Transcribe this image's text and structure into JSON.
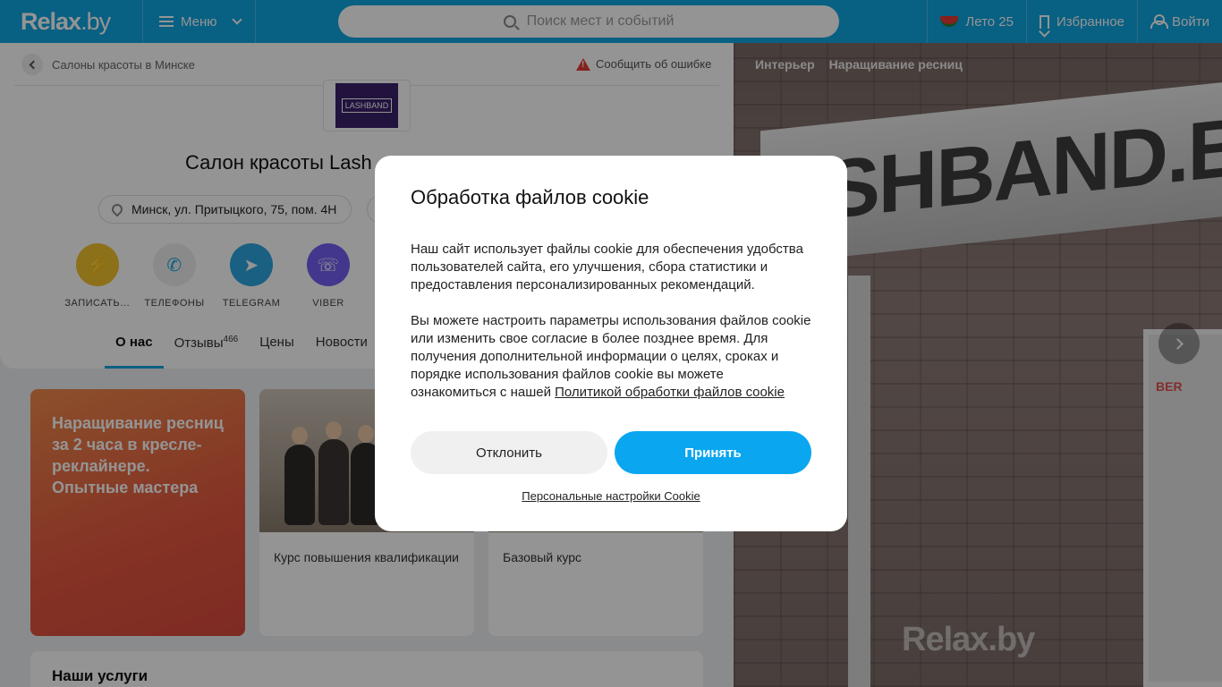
{
  "header": {
    "logo": "Relax",
    "logo_suffix": ".by",
    "menu_label": "Меню",
    "search_placeholder": "Поиск мест и событий",
    "summer_label": "Лето 25",
    "favorites_label": "Избранное",
    "login_label": "Войти",
    "accent_color": "#0ea5e0"
  },
  "breadcrumb": {
    "label": "Салоны красоты в Минске",
    "report_label": "Сообщить об ошибке"
  },
  "salon": {
    "logo_text": "LASHBAND",
    "title_visible": "Салон красоты Lash",
    "address": "Минск, ул. Притыцкого, 75, пом. 4Н"
  },
  "actions": [
    {
      "label": "ЗАПИСАТЬ…",
      "icon": "lightning-icon",
      "color": "#f2c12e"
    },
    {
      "label": "ТЕЛЕФОНЫ",
      "icon": "phone-icon",
      "color": "#eeeeee"
    },
    {
      "label": "TELEGRAM",
      "icon": "telegram-icon",
      "color": "#2ca5e0"
    },
    {
      "label": "VIBER",
      "icon": "viber-icon",
      "color": "#7360f2"
    }
  ],
  "tabs": [
    {
      "label": "О нас",
      "active": true
    },
    {
      "label": "Отзывы",
      "count": "466"
    },
    {
      "label": "Цены"
    },
    {
      "label": "Новости"
    }
  ],
  "promo": {
    "text": "Наращивание ресниц за 2 часа в кресле-реклайнере. Опытные мастера"
  },
  "courses": [
    {
      "caption": "Курс повышения квалификации"
    },
    {
      "caption": "Базовый курс"
    }
  ],
  "services_title": "Наши услуги",
  "photo": {
    "tags": [
      "Интерьер",
      "Наращивание ресниц"
    ],
    "sign_text": "ASHBAND.B",
    "door_text": "BER",
    "watermark": "Relax.by"
  },
  "cookie": {
    "title": "Обработка файлов cookie",
    "paragraph1": "Наш сайт использует файлы cookie для обеспечения удобства пользователей сайта, его улучшения, сбора статистики и предоставления персонализированных рекомендаций.",
    "paragraph2": "Вы можете настроить параметры использования файлов cookie или изменить свое согласие в более позднее время. Для получения дополнительной информации о целях, сроках и порядке использования файлов cookie вы можете ознакомиться с нашей",
    "policy_link": "Политикой обработки файлов cookie",
    "decline_label": "Отклонить",
    "accept_label": "Принять",
    "settings_link": "Персональные настройки Cookie"
  }
}
